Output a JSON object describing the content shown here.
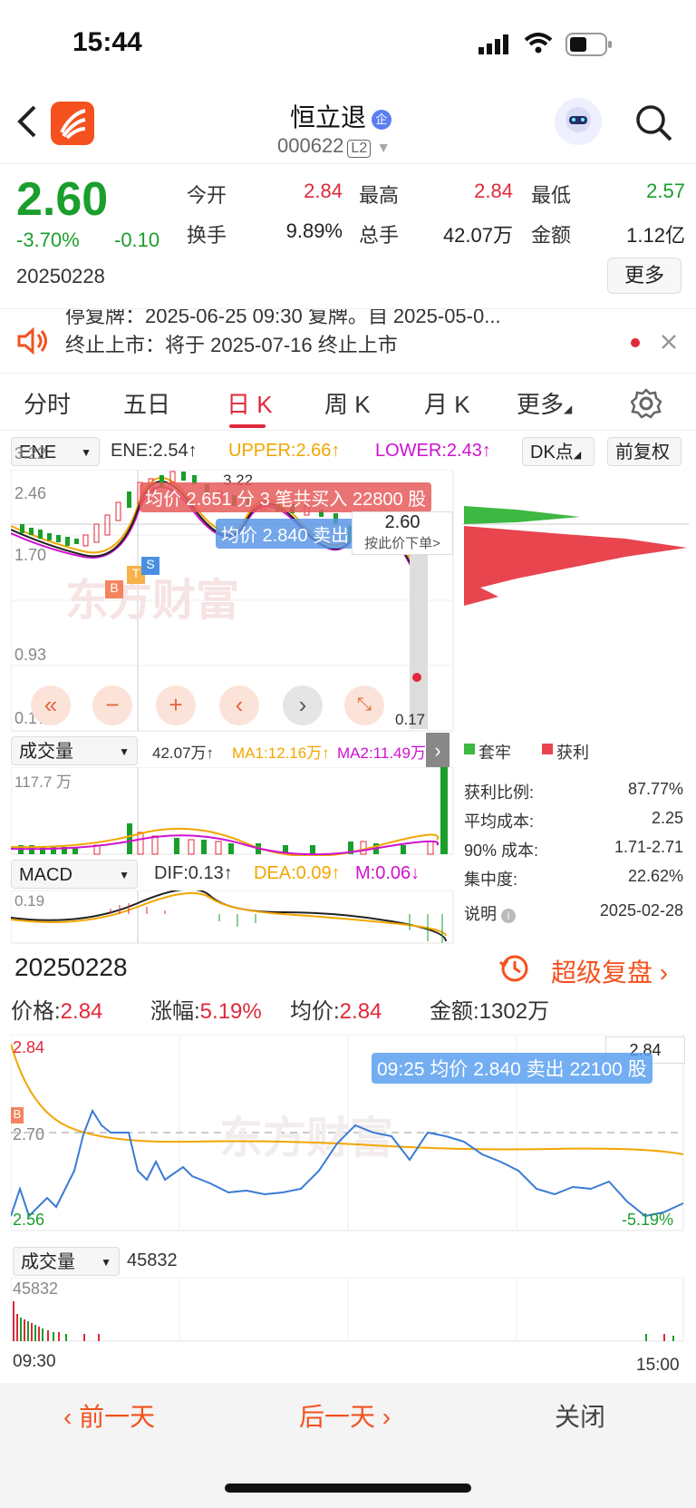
{
  "status": {
    "time": "15:44"
  },
  "header": {
    "title": "恒立退",
    "badge": "企",
    "code": "000622",
    "level": "L2"
  },
  "quote": {
    "price": "2.60",
    "change_pct": "-3.70%",
    "change": "-0.10",
    "date": "20250228",
    "open_label": "今开",
    "open": "2.84",
    "high_label": "最高",
    "high": "2.84",
    "low_label": "最低",
    "low": "2.57",
    "turnover_label": "换手",
    "turnover": "9.89%",
    "volume_label": "总手",
    "volume": "42.07万",
    "amount_label": "金额",
    "amount": "1.12亿",
    "more_label": "更多"
  },
  "notice": {
    "line1": "停复牌：2025-06-25 09:30 复牌。自 2025-05-0...",
    "line2": "终止上市：将于 2025-07-16 终止上市"
  },
  "tabs": [
    "分时",
    "五日",
    "日 K",
    "周 K",
    "月 K",
    "更多"
  ],
  "active_tab": "日 K",
  "kline": {
    "indicator": "ENE",
    "ene": "ENE:2.54↑",
    "upper": "UPPER:2.66↑",
    "lower": "LOWER:2.43↑",
    "dk_label": "DK点",
    "adjust_label": "前复权",
    "y_ticks": [
      "3.22",
      "2.46",
      "1.70",
      "0.93",
      "0.17"
    ],
    "high_marker": "3.22",
    "low_marker": "0.17",
    "buy_callout": "均价 2.651 分 3 笔共买入 22800 股",
    "sell_callout": "均价 2.840 卖出",
    "price_tip": "2.60",
    "order_tip": "按此价下单>",
    "watermark": "东方财富"
  },
  "volume_panel": {
    "label": "成交量",
    "vol": "42.07万↑",
    "ma1": "MA1:12.16万↑",
    "ma2": "MA2:11.49万",
    "max": "117.7 万"
  },
  "macd_panel": {
    "label": "MACD",
    "dif": "DIF:0.13↑",
    "dea": "DEA:0.09↑",
    "m": "M:0.06↓",
    "top": "0.19"
  },
  "chips": {
    "legend_trap": "套牢",
    "legend_profit": "获利",
    "rows": [
      {
        "label": "获利比例:",
        "value": "87.77%"
      },
      {
        "label": "平均成本:",
        "value": "2.25"
      },
      {
        "label": "90% 成本:",
        "value": "1.71-2.71"
      },
      {
        "label": "集中度:",
        "value": "22.62%"
      }
    ],
    "note_label": "说明",
    "note_date": "2025-02-28"
  },
  "detail": {
    "date": "20250228",
    "replay_label": "超级复盘",
    "price_label": "价格:",
    "price": "2.84",
    "chg_label": "涨幅:",
    "chg": "5.19%",
    "avg_label": "均价:",
    "avg": "2.84",
    "amt_label": "金额:",
    "amt": "1302万",
    "y_top": "2.84",
    "y_mid": "2.70",
    "y_bottom": "2.56",
    "right_top": "2.84",
    "right_bottom": "-5.19%",
    "callout": "09:25 均价 2.840 卖出 22100 股",
    "vol_label": "成交量",
    "vol_value": "45832",
    "vol_max": "45832",
    "t_start": "09:30",
    "t_end": "15:00"
  },
  "bottom": {
    "prev": "前一天",
    "next": "后一天",
    "close": "关闭"
  },
  "colors": {
    "up": "#e0293a",
    "down": "#1a9e2c",
    "accent": "#f4511e"
  }
}
